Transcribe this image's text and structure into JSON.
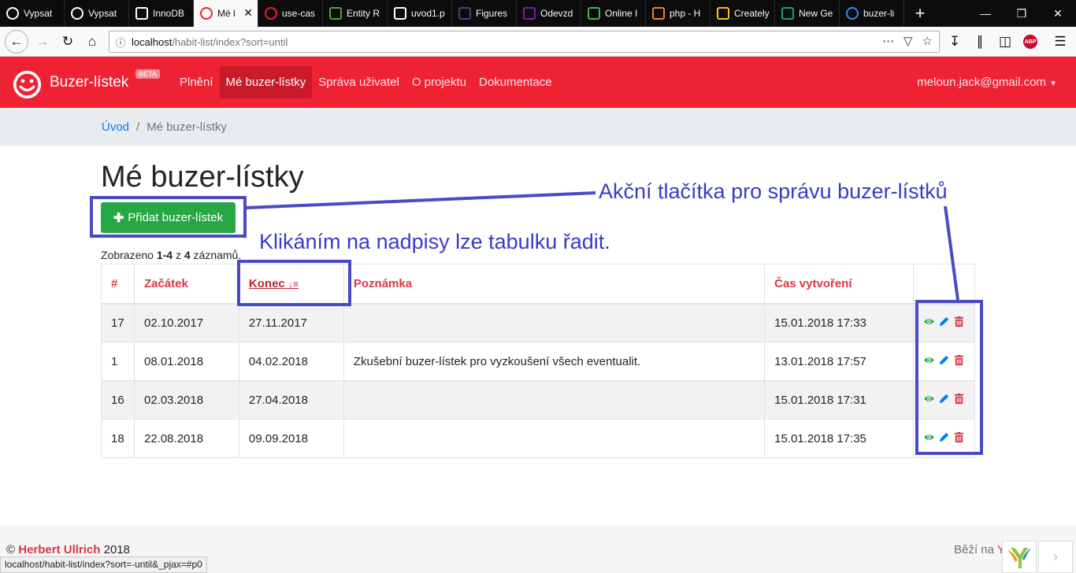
{
  "browser": {
    "tabs": [
      {
        "title": "Vypsat",
        "icon": "github-icon",
        "color": "#ffffff"
      },
      {
        "title": "Vypsat",
        "icon": "github-icon",
        "color": "#ffffff"
      },
      {
        "title": "InnoDB",
        "icon": "wikipedia-icon",
        "color": "#ffffff"
      },
      {
        "title": "Mé l",
        "icon": "smiley-icon",
        "color": "#ee2233",
        "active": true
      },
      {
        "title": "use-cas",
        "icon": "smiley-icon",
        "color": "#ee2233"
      },
      {
        "title": "Entity R",
        "icon": "vp-icon",
        "color": "#5aa02c"
      },
      {
        "title": "uvod1.p",
        "icon": "page-icon",
        "color": "#ffffff"
      },
      {
        "title": "Figures",
        "icon": "bootstrap-icon",
        "color": "#563d7c"
      },
      {
        "title": "Odevzd",
        "icon": "form-icon",
        "color": "#7b1fa2"
      },
      {
        "title": "Online I",
        "icon": "code-icon",
        "color": "#4caf50"
      },
      {
        "title": "php - H",
        "icon": "stackoverflow-icon",
        "color": "#f48024"
      },
      {
        "title": "Creately",
        "icon": "bulb-icon",
        "color": "#f5c518"
      },
      {
        "title": "New Ge",
        "icon": "sheet-icon",
        "color": "#1da362"
      },
      {
        "title": "buzer-li",
        "icon": "google-icon",
        "color": "#4285f4"
      }
    ],
    "url_host": "localhost",
    "url_path": "/habit-list/index?sort=until",
    "status_url": "localhost/habit-list/index?sort=-until&_pjax=#p0"
  },
  "site": {
    "brand": "Buzer-lístek",
    "beta": "BETA",
    "menu": [
      {
        "label": "Plnění",
        "active": false
      },
      {
        "label": "Mé buzer-lístky",
        "active": true
      },
      {
        "label": "Správa uživatel",
        "active": false
      },
      {
        "label": "O projektu",
        "active": false
      },
      {
        "label": "Dokumentace",
        "active": false
      }
    ],
    "user": "meloun.jack@gmail.com"
  },
  "breadcrumb": {
    "home": "Úvod",
    "current": "Mé buzer-lístky",
    "separator": "/"
  },
  "page": {
    "title": "Mé buzer-lístky",
    "add_button": "Přidat buzer-lístek",
    "summary_prefix": "Zobrazeno ",
    "summary_range": "1-4",
    "summary_mid": " z ",
    "summary_total": "4",
    "summary_suffix": " záznamů."
  },
  "table": {
    "headers": [
      "#",
      "Začátek",
      "Konec",
      "Poznámka",
      "Čas vytvoření",
      ""
    ],
    "sort_indicator": "↓≡",
    "rows": [
      {
        "id": "17",
        "start": "02.10.2017",
        "end": "27.11.2017",
        "note": "",
        "created": "15.01.2018 17:33"
      },
      {
        "id": "1",
        "start": "08.01.2018",
        "end": "04.02.2018",
        "note": "Zkušební buzer-lístek pro vyzkoušení všech eventualit.",
        "created": "13.01.2018 17:57"
      },
      {
        "id": "16",
        "start": "02.03.2018",
        "end": "27.04.2018",
        "note": "",
        "created": "15.01.2018 17:31"
      },
      {
        "id": "18",
        "start": "22.08.2018",
        "end": "09.09.2018",
        "note": "",
        "created": "15.01.2018 17:35"
      }
    ]
  },
  "annotations": {
    "actions_note": "Akční tlačítka pro správu buzer-lístků",
    "sort_note": "Klikáním na nadpisy lze tabulku řadit."
  },
  "footer": {
    "copy_symbol": "©",
    "author": "Herbert Ullrich",
    "year": "2018",
    "powered_prefix": "Běží na ",
    "powered_yii": "Yii"
  },
  "colors": {
    "brand": "#ee2233",
    "success": "#28a745",
    "annotation": "#4a4ac4"
  }
}
